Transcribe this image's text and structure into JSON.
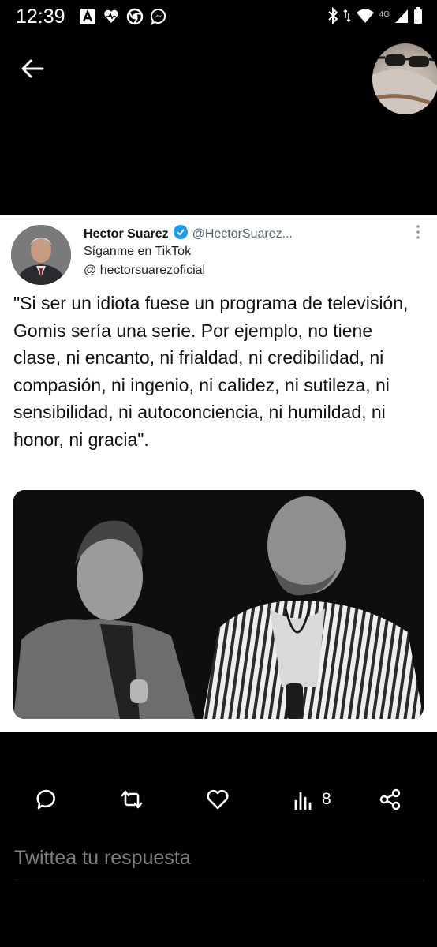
{
  "status_bar": {
    "time": "12:39",
    "network": "4G"
  },
  "tweet": {
    "author_name": "Hector Suarez",
    "handle": "@HectorSuarez...",
    "bio_line1": "Síganme en TikTok",
    "bio_line2": "@ hectorsuarezoficial",
    "text": "\"Si ser un idiota fuese un programa de televisión, Gomis sería una serie. Por ejemplo, no tiene clase, ni encanto, ni frialdad, ni credibilidad, ni compasión, ni ingenio, ni calidez, ni sutileza, ni sensibilidad, ni autoconciencia, ni humildad, ni honor, ni gracia\"."
  },
  "actions": {
    "views_count": "8"
  },
  "reply": {
    "placeholder": "Twittea tu respuesta"
  },
  "colors": {
    "background": "#000000",
    "card": "#ffffff",
    "verified": "#1d9bf0",
    "placeholder": "#7b8085"
  }
}
